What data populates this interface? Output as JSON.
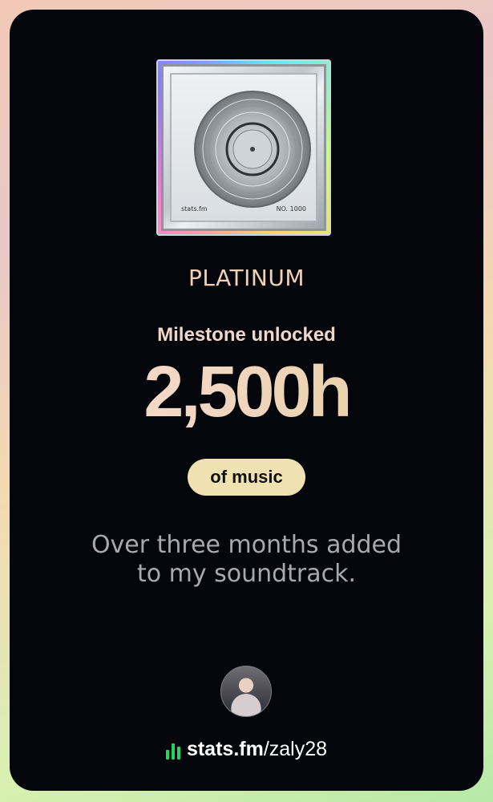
{
  "plaque": {
    "brand": "stats.fm",
    "number": "NO. 1000"
  },
  "tier": "PLATINUM",
  "subtitle": "Milestone unlocked",
  "value": "2,500h",
  "unit_pill": "of music",
  "caption": {
    "line1": "Over three months added",
    "line2": "to my soundtrack."
  },
  "footer": {
    "domain": "stats.fm",
    "username": "/zaly28",
    "icon": "stats-bars-icon"
  },
  "colors": {
    "pill_bg": "#efe1b1",
    "brand_green": "#1ed760",
    "card_bg": "#05060b"
  }
}
